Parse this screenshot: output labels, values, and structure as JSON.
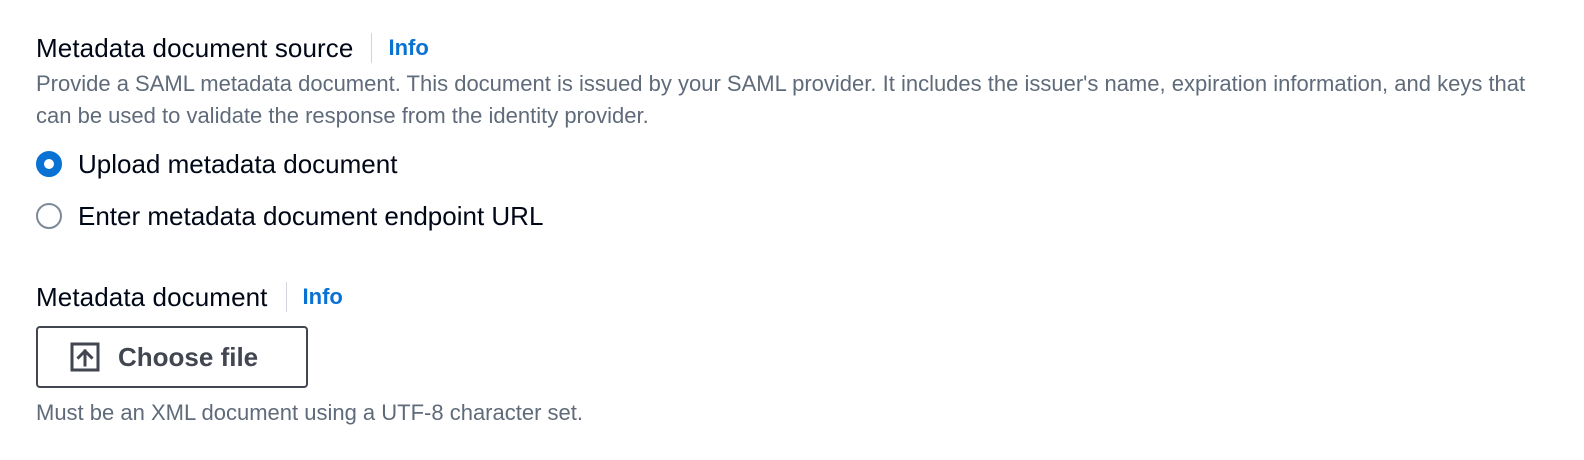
{
  "metadata_source": {
    "label": "Metadata document source",
    "info_label": "Info",
    "description": "Provide a SAML metadata document. This document is issued by your SAML provider. It includes the issuer's name, expiration information, and keys that can be used to validate the response from the identity provider.",
    "options": [
      {
        "label": "Upload metadata document",
        "selected": true
      },
      {
        "label": "Enter metadata document endpoint URL",
        "selected": false
      }
    ]
  },
  "metadata_document": {
    "label": "Metadata document",
    "info_label": "Info",
    "button_label": "Choose file",
    "button_icon": "upload-icon",
    "constraint": "Must be an XML document using a UTF-8 character set."
  },
  "colors": {
    "accent": "#0972d3",
    "text": "#000716",
    "secondary_text": "#5f6b7a",
    "button_border": "#424650"
  }
}
